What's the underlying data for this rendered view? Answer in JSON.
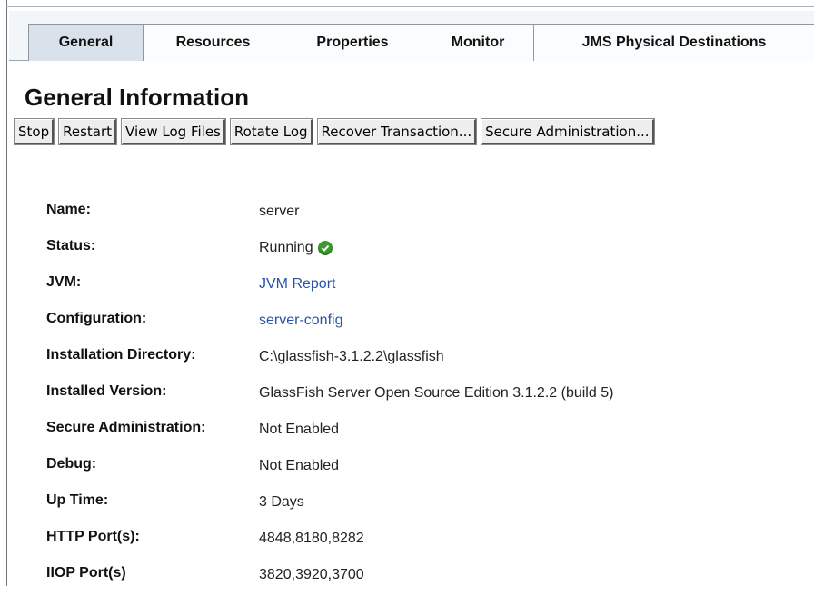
{
  "tabs": [
    {
      "label": "General",
      "active": true
    },
    {
      "label": "Resources"
    },
    {
      "label": "Properties"
    },
    {
      "label": "Monitor"
    },
    {
      "label": "JMS Physical Destinations"
    }
  ],
  "page_title": "General Information",
  "buttons": [
    "Stop",
    "Restart",
    "View Log Files",
    "Rotate Log",
    "Recover Transaction...",
    "Secure Administration..."
  ],
  "info": {
    "name_label": "Name:",
    "name_value": "server",
    "status_label": "Status:",
    "status_value": "Running",
    "status_icon": "check-circle-icon",
    "jvm_label": "JVM:",
    "jvm_value": "JVM Report",
    "configuration_label": "Configuration:",
    "configuration_value": "server-config",
    "install_dir_label": "Installation Directory:",
    "install_dir_value": "C:\\glassfish-3.1.2.2\\glassfish",
    "installed_version_label": "Installed Version:",
    "installed_version_value": "GlassFish Server Open Source Edition 3.1.2.2 (build 5)",
    "secure_admin_label": "Secure Administration:",
    "secure_admin_value": "Not Enabled",
    "debug_label": "Debug:",
    "debug_value": "Not Enabled",
    "uptime_label": "Up Time:",
    "uptime_value": "3 Days",
    "http_ports_label": "HTTP Port(s):",
    "http_ports_value": "4848,8180,8282",
    "iiop_ports_label": "IIOP Port(s)",
    "iiop_ports_value": "3820,3920,3700"
  },
  "colors": {
    "link": "#2a53a8",
    "active_tab": "#d9e2ea",
    "status_ok": "#3a9b2b"
  }
}
